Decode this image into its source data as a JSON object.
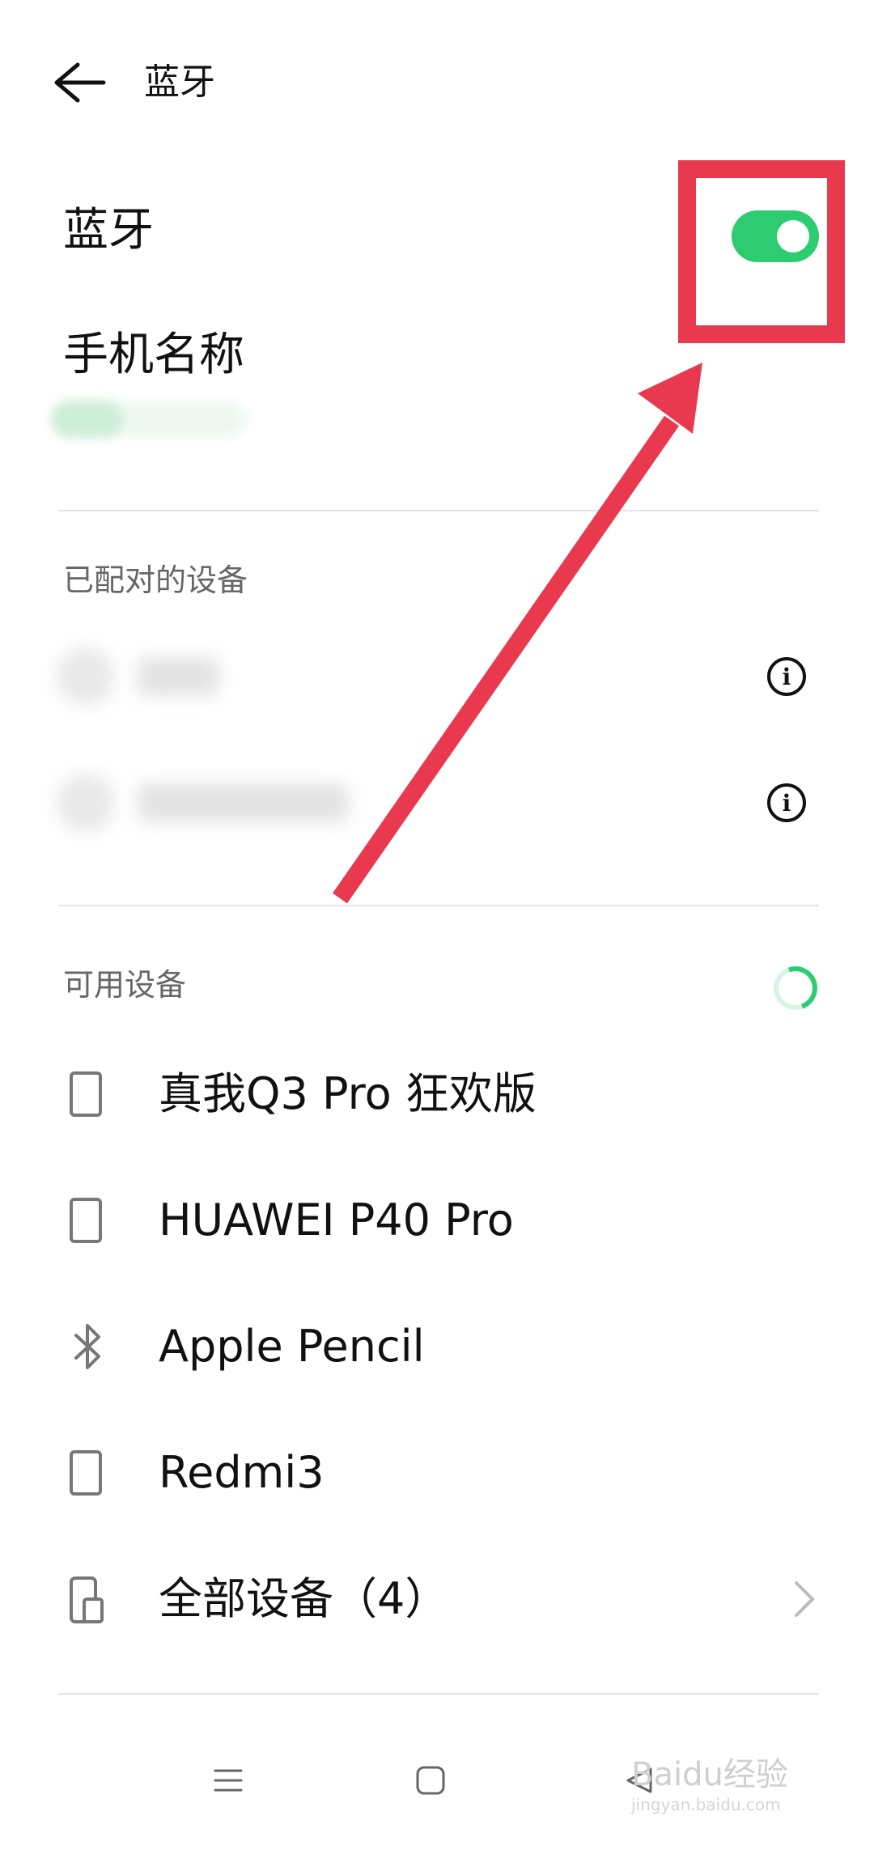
{
  "header": {
    "title": "蓝牙"
  },
  "bluetooth": {
    "label": "蓝牙",
    "enabled": true,
    "toggle_color": "#2ecc71"
  },
  "phone_name": {
    "label": "手机名称"
  },
  "paired": {
    "section_title": "已配对的设备",
    "items": [
      {
        "info_icon": "info-icon"
      },
      {
        "info_icon": "info-icon"
      }
    ]
  },
  "available": {
    "section_title": "可用设备",
    "devices": [
      {
        "name": "真我Q3 Pro 狂欢版",
        "icon": "phone-icon"
      },
      {
        "name": "HUAWEI P40 Pro",
        "icon": "phone-icon"
      },
      {
        "name": "Apple Pencil",
        "icon": "bluetooth-icon"
      },
      {
        "name": "Redmi3",
        "icon": "phone-icon"
      }
    ],
    "all_devices": "全部设备（4）"
  },
  "annotation": {
    "color": "#e9394f"
  },
  "watermark": {
    "text": "Baidu经验",
    "url_text": "jingyan.baidu.com"
  }
}
